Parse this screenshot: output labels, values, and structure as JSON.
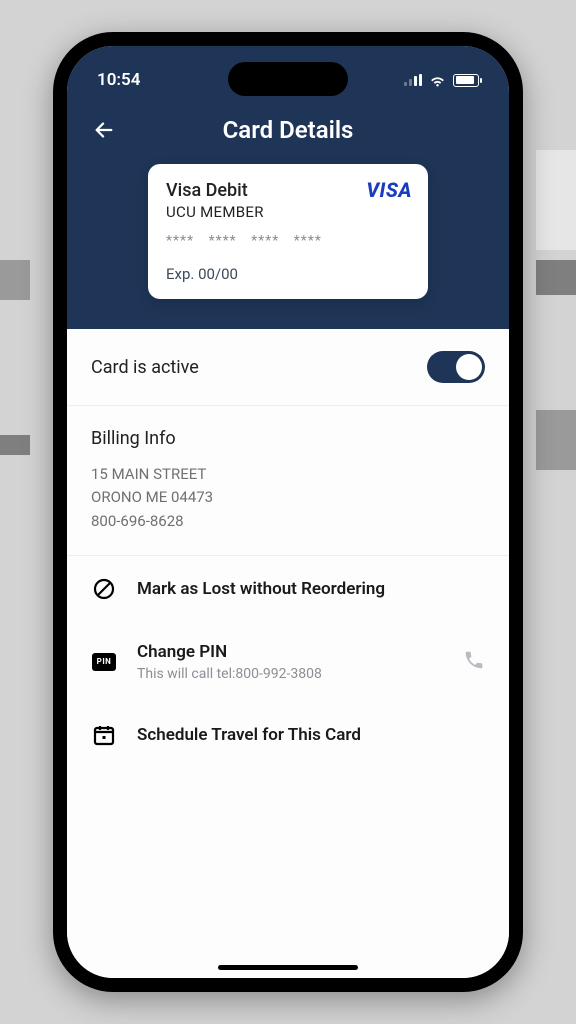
{
  "statusbar": {
    "time": "10:54"
  },
  "header": {
    "title": "Card Details"
  },
  "card": {
    "name": "Visa Debit",
    "holder": "UCU MEMBER",
    "masked": "****  ****  ****  ****",
    "expiry_label": "Exp. 00/00",
    "brand": "VISA"
  },
  "active_row": {
    "label": "Card is active",
    "on": true
  },
  "billing": {
    "title": "Billing Info",
    "line1": "15 MAIN STREET",
    "line2": "ORONO ME 04473",
    "phone": "800-696-8628"
  },
  "actions": {
    "lost": {
      "title": "Mark as Lost without Reordering"
    },
    "pin": {
      "title": "Change PIN",
      "subtitle": "This will call tel:800-992-3808",
      "chip": "PIN"
    },
    "travel": {
      "title": "Schedule Travel for This Card"
    }
  }
}
